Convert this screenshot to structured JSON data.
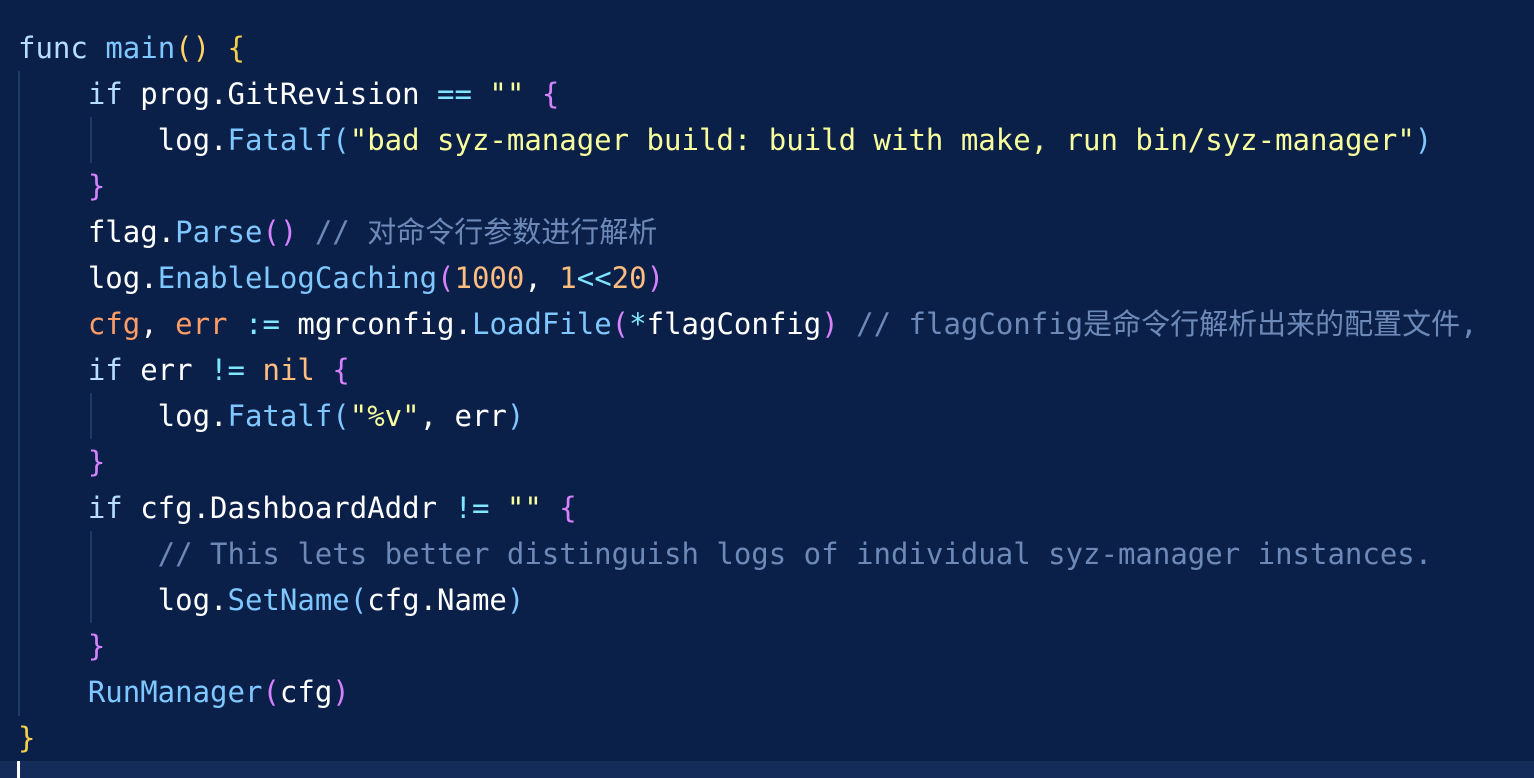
{
  "editor": {
    "lines": [
      {
        "tokens": [
          {
            "text": "func ",
            "class": "tok-kw",
            "name": "keyword-func"
          },
          {
            "text": "main",
            "class": "tok-fn",
            "name": "function-main"
          },
          {
            "text": "()",
            "class": "tok-paren",
            "name": "main-params"
          },
          {
            "text": " ",
            "class": "tok-var",
            "name": "space"
          },
          {
            "text": "{",
            "class": "tok-brace-1",
            "name": "main-open-brace"
          }
        ]
      },
      {
        "tokens": [
          {
            "text": "    if ",
            "class": "tok-kw",
            "name": "keyword-if"
          },
          {
            "text": "prog.GitRevision",
            "class": "tok-var",
            "name": "prog-gitrevision"
          },
          {
            "text": " == ",
            "class": "tok-op",
            "name": "operator-equals"
          },
          {
            "text": "\"\"",
            "class": "tok-str",
            "name": "empty-string"
          },
          {
            "text": " ",
            "class": "tok-var",
            "name": "space"
          },
          {
            "text": "{",
            "class": "tok-brace-2",
            "name": "if-open-brace"
          }
        ]
      },
      {
        "tokens": [
          {
            "text": "        log.",
            "class": "tok-var",
            "name": "log-object"
          },
          {
            "text": "Fatalf",
            "class": "tok-fn",
            "name": "function-fatalf"
          },
          {
            "text": "(",
            "class": "tok-fn",
            "name": "open-paren"
          },
          {
            "text": "\"bad syz-manager build: build with make, run bin/syz-manager\"",
            "class": "tok-str",
            "name": "fatal-message"
          },
          {
            "text": ")",
            "class": "tok-fn",
            "name": "close-paren"
          }
        ]
      },
      {
        "tokens": [
          {
            "text": "    }",
            "class": "tok-brace-2",
            "name": "if-close-brace"
          }
        ]
      },
      {
        "tokens": [
          {
            "text": "    flag.",
            "class": "tok-var",
            "name": "flag-object"
          },
          {
            "text": "Parse",
            "class": "tok-fn",
            "name": "function-parse"
          },
          {
            "text": "()",
            "class": "tok-brace-2",
            "name": "parse-parens"
          },
          {
            "text": " // 对命令行参数进行解析",
            "class": "tok-comment",
            "name": "comment-parse"
          }
        ]
      },
      {
        "tokens": [
          {
            "text": "    log.",
            "class": "tok-var",
            "name": "log-object"
          },
          {
            "text": "EnableLogCaching",
            "class": "tok-fn",
            "name": "function-enablelogcaching"
          },
          {
            "text": "(",
            "class": "tok-brace-2",
            "name": "open-paren"
          },
          {
            "text": "1000",
            "class": "tok-num",
            "name": "number-1000"
          },
          {
            "text": ", ",
            "class": "tok-var",
            "name": "comma"
          },
          {
            "text": "1",
            "class": "tok-num",
            "name": "number-1"
          },
          {
            "text": "<<",
            "class": "tok-op",
            "name": "operator-shift"
          },
          {
            "text": "20",
            "class": "tok-num",
            "name": "number-20"
          },
          {
            "text": ")",
            "class": "tok-brace-2",
            "name": "close-paren"
          }
        ]
      },
      {
        "tokens": [
          {
            "text": "    cfg",
            "class": "tok-type",
            "name": "variable-cfg"
          },
          {
            "text": ", ",
            "class": "tok-var",
            "name": "comma"
          },
          {
            "text": "err",
            "class": "tok-type",
            "name": "variable-err"
          },
          {
            "text": " := ",
            "class": "tok-op",
            "name": "operator-assign"
          },
          {
            "text": "mgrconfig.",
            "class": "tok-var",
            "name": "mgrconfig-object"
          },
          {
            "text": "LoadFile",
            "class": "tok-fn",
            "name": "function-loadfile"
          },
          {
            "text": "(",
            "class": "tok-brace-2",
            "name": "open-paren"
          },
          {
            "text": "*",
            "class": "tok-op",
            "name": "operator-deref"
          },
          {
            "text": "flagConfig",
            "class": "tok-var",
            "name": "variable-flagconfig"
          },
          {
            "text": ")",
            "class": "tok-brace-2",
            "name": "close-paren"
          },
          {
            "text": " // flagConfig是命令行解析出来的配置文件,",
            "class": "tok-comment",
            "name": "comment-flagconfig"
          }
        ]
      },
      {
        "tokens": [
          {
            "text": "    if ",
            "class": "tok-kw",
            "name": "keyword-if"
          },
          {
            "text": "err",
            "class": "tok-var",
            "name": "variable-err"
          },
          {
            "text": " != ",
            "class": "tok-op",
            "name": "operator-not-equals"
          },
          {
            "text": "nil",
            "class": "tok-num",
            "name": "nil-value"
          },
          {
            "text": " ",
            "class": "tok-var",
            "name": "space"
          },
          {
            "text": "{",
            "class": "tok-brace-2",
            "name": "if-open-brace"
          }
        ]
      },
      {
        "tokens": [
          {
            "text": "        log.",
            "class": "tok-var",
            "name": "log-object"
          },
          {
            "text": "Fatalf",
            "class": "tok-fn",
            "name": "function-fatalf"
          },
          {
            "text": "(",
            "class": "tok-fn",
            "name": "open-paren"
          },
          {
            "text": "\"%v\"",
            "class": "tok-str",
            "name": "format-string"
          },
          {
            "text": ", err",
            "class": "tok-var",
            "name": "argument-err"
          },
          {
            "text": ")",
            "class": "tok-fn",
            "name": "close-paren"
          }
        ]
      },
      {
        "tokens": [
          {
            "text": "    }",
            "class": "tok-brace-2",
            "name": "if-close-brace"
          }
        ]
      },
      {
        "tokens": [
          {
            "text": "    if ",
            "class": "tok-kw",
            "name": "keyword-if"
          },
          {
            "text": "cfg.DashboardAddr",
            "class": "tok-var",
            "name": "cfg-dashboardaddr"
          },
          {
            "text": " != ",
            "class": "tok-op",
            "name": "operator-not-equals"
          },
          {
            "text": "\"\"",
            "class": "tok-str",
            "name": "empty-string"
          },
          {
            "text": " ",
            "class": "tok-var",
            "name": "space"
          },
          {
            "text": "{",
            "class": "tok-brace-2",
            "name": "if-open-brace"
          }
        ]
      },
      {
        "tokens": [
          {
            "text": "        // This lets better distinguish logs of individual syz-manager instances.",
            "class": "tok-comment",
            "name": "comment-distinguish-logs"
          }
        ]
      },
      {
        "tokens": [
          {
            "text": "        log.",
            "class": "tok-var",
            "name": "log-object"
          },
          {
            "text": "SetName",
            "class": "tok-fn",
            "name": "function-setname"
          },
          {
            "text": "(",
            "class": "tok-fn",
            "name": "open-paren"
          },
          {
            "text": "cfg.Name",
            "class": "tok-var",
            "name": "cfg-name"
          },
          {
            "text": ")",
            "class": "tok-fn",
            "name": "close-paren"
          }
        ]
      },
      {
        "tokens": [
          {
            "text": "    }",
            "class": "tok-brace-2",
            "name": "if-close-brace"
          }
        ]
      },
      {
        "tokens": [
          {
            "text": "    RunManager",
            "class": "tok-fn",
            "name": "function-runmanager"
          },
          {
            "text": "(",
            "class": "tok-brace-2",
            "name": "open-paren"
          },
          {
            "text": "cfg",
            "class": "tok-var",
            "name": "argument-cfg"
          },
          {
            "text": ")",
            "class": "tok-brace-2",
            "name": "close-paren"
          }
        ]
      },
      {
        "tokens": [
          {
            "text": "}",
            "class": "tok-brace-1",
            "name": "main-close-brace"
          }
        ]
      }
    ]
  },
  "colors": {
    "background": "#0b2049",
    "current_line": "#142c5a",
    "cursor": "#ffffff"
  }
}
